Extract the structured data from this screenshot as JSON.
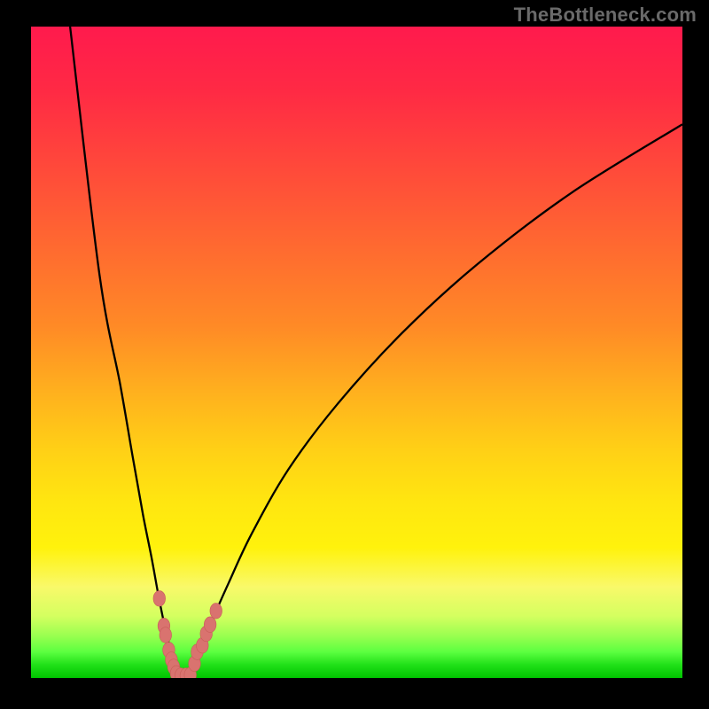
{
  "watermark": "TheBottleneck.com",
  "colors": {
    "background_frame": "#000000",
    "curve": "#000000",
    "marker_fill": "#d9736f",
    "marker_stroke": "#c85d58",
    "gradient_top": "#ff1a4d",
    "gradient_bottom": "#00c400"
  },
  "chart_data": {
    "type": "line",
    "title": "",
    "xlabel": "",
    "ylabel": "",
    "xlim": [
      0,
      100
    ],
    "ylim": [
      0,
      100
    ],
    "grid": false,
    "note": "Two branches of a V-shaped bottleneck curve. y is relative height 0..100 (0 = bottom/green, 100 = top/red). x is horizontal position 0..100 across the gradient area.",
    "series": [
      {
        "name": "left_branch",
        "x": [
          6,
          10.5,
          13.7,
          15.6,
          17.2,
          18.5,
          19.5,
          20.3,
          21,
          21.5,
          22,
          22.6
        ],
        "y": [
          100,
          62,
          45,
          34,
          25,
          18.5,
          13,
          9,
          6,
          3.8,
          2,
          0.3
        ]
      },
      {
        "name": "right_branch",
        "x": [
          24.5,
          25.4,
          26.5,
          28.3,
          30.3,
          33.8,
          39.5,
          47,
          57,
          68.5,
          83,
          100
        ],
        "y": [
          0.3,
          2.5,
          5.5,
          10,
          14.5,
          22,
          32,
          42,
          53,
          63.5,
          74.5,
          85
        ]
      }
    ],
    "markers": {
      "name": "scatter_points",
      "x": [
        19.7,
        20.4,
        20.65,
        21.15,
        21.55,
        21.9,
        22.3,
        23.0,
        23.8,
        24.45,
        25.1,
        25.5,
        26.3,
        26.9,
        27.5,
        28.4
      ],
      "y": [
        12.2,
        8.0,
        6.6,
        4.3,
        2.8,
        1.7,
        0.7,
        0.35,
        0.35,
        0.45,
        2.2,
        4.0,
        5.0,
        6.8,
        8.2,
        10.3
      ]
    }
  }
}
